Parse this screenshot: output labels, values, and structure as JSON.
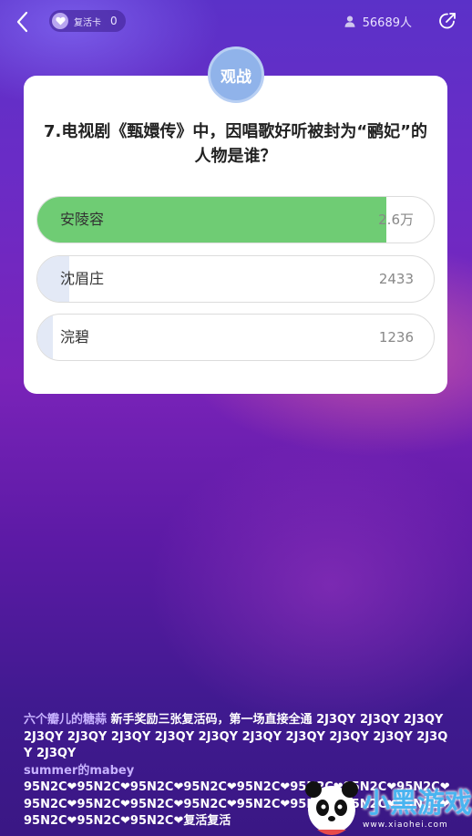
{
  "header": {
    "revive_label": "复活卡",
    "revive_count": "0",
    "viewer_count": "56689人"
  },
  "badge": {
    "label": "观战"
  },
  "question": {
    "line1": "7.电视剧《甄嬛传》中，因唱歌好听被封为“鹂妃”的",
    "line2": "人物是谁？"
  },
  "options": [
    {
      "name": "安陵容",
      "count": "2.6万",
      "share": 0.88,
      "color": "#6fcc74",
      "correct": true
    },
    {
      "name": "沈眉庄",
      "count": "2433",
      "share": 0.08,
      "color": "#e3e9f6",
      "correct": false
    },
    {
      "name": "浣碧",
      "count": "1236",
      "share": 0.04,
      "color": "#e3e9f6",
      "correct": false
    }
  ],
  "chat": [
    {
      "user": "六个瓣儿的糖蒜",
      "text": "新手奖励三张复活码，第一场直接全通 2J3QY 2J3QY 2J3QY 2J3QY 2J3QY 2J3QY 2J3QY 2J3QY 2J3QY 2J3QY 2J3QY 2J3QY 2J3QY 2J3QY"
    },
    {
      "user": "summer的mabey",
      "text": "95N2C❤95N2C❤95N2C❤95N2C❤95N2C❤95N2C❤95N2C❤95N2C❤95N2C❤95N2C❤95N2C❤95N2C❤95N2C❤95N2C❤95N2C❤95N2C❤95N2C❤95N2C❤95N2C❤复活复活"
    }
  ],
  "watermark": {
    "text": "小黑游戏",
    "url": "www.xiaohei.com"
  },
  "colors": {
    "accent_green": "#6fcc74",
    "badge_blue": "#90b3ea",
    "username": "#c7b2ff"
  }
}
